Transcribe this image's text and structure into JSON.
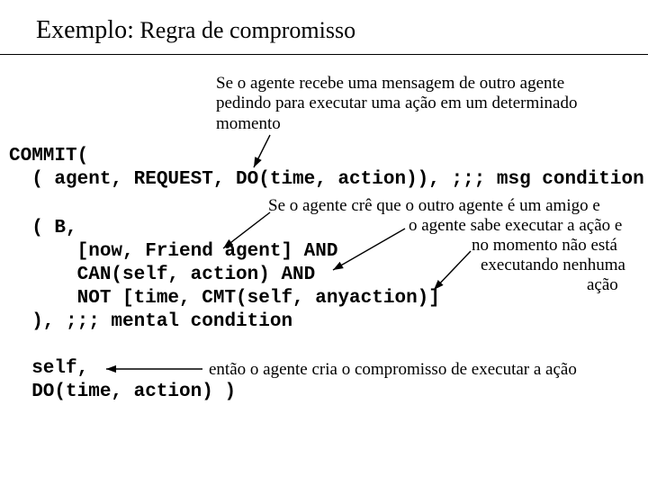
{
  "title": {
    "main": "Exemplo:",
    "sub": " Regra de compromisso"
  },
  "annot": {
    "a1": "Se o agente recebe uma mensagem de outro agente pedindo para executar uma ação em um determinado momento",
    "a2_l1": "Se o agente crê que o outro agente é um amigo e",
    "a2_l2": "o agente sabe executar a ação e",
    "a2_l3": "no momento não está",
    "a2_l4": "executando nenhuma",
    "a2_l5": "ação",
    "a3": "então o agente cria o compromisso de executar a ação"
  },
  "code": {
    "l1": "COMMIT(",
    "l2": "  ( agent, REQUEST, DO(time, action)), ;;; msg condition",
    "l3": "  ( B,",
    "l4": "      [now, Friend agent] AND",
    "l5": "      CAN(self, action) AND",
    "l6": "      NOT [time, CMT(self, anyaction)]",
    "l7": "  ), ;;; mental condition",
    "l8": "  self,",
    "l9": "  DO(time, action) )"
  }
}
